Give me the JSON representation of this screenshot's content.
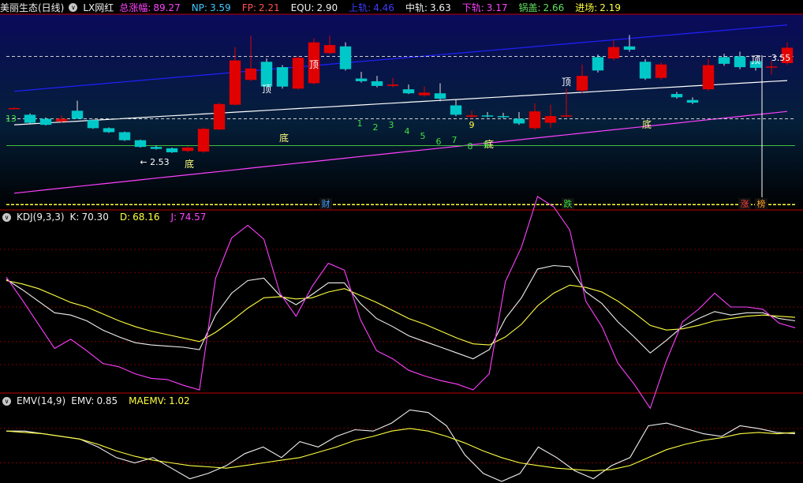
{
  "main_header": {
    "stock_name": "美丽生态(日线)",
    "indicator_name": "LX网红",
    "items": [
      {
        "label": "总涨幅:",
        "value": "89.27",
        "color": "#ff40ff"
      },
      {
        "label": "NP:",
        "value": "3.59",
        "color": "#40c8ff"
      },
      {
        "label": "FP:",
        "value": "2.21",
        "color": "#ff5050"
      },
      {
        "label": "EQU:",
        "value": "2.90",
        "color": "#f0f0f0"
      },
      {
        "label": "上轨:",
        "value": "4.46",
        "color": "#3c3cff"
      },
      {
        "label": "中轨:",
        "value": "3.63",
        "color": "#f0f0f0"
      },
      {
        "label": "下轨:",
        "value": "3.17",
        "color": "#ff40ff"
      },
      {
        "label": "锅盖:",
        "value": "2.66",
        "color": "#60e060"
      },
      {
        "label": "进场:",
        "value": "2.19",
        "color": "#ffff40"
      }
    ]
  },
  "kdj_header": {
    "title": "KDJ(9,3,3)",
    "items": [
      {
        "label": "K:",
        "value": "70.30",
        "color": "#f0f0f0"
      },
      {
        "label": "D:",
        "value": "68.16",
        "color": "#ffff40"
      },
      {
        "label": "J:",
        "value": "74.57",
        "color": "#ff40ff"
      }
    ]
  },
  "emv_header": {
    "title": "EMV(14,9)",
    "items": [
      {
        "label": "EMV:",
        "value": "0.85",
        "color": "#f0f0f0"
      },
      {
        "label": "MAEMV:",
        "value": "1.02",
        "color": "#ffff40"
      }
    ]
  },
  "colors": {
    "up": "#e00000",
    "down": "#00c8c8",
    "mid": "#ffffff",
    "lower": "#ff40ff",
    "upper": "#2020ff",
    "entry": "#ffff40",
    "pot": "#40c040",
    "kdj_k": "#f0f0f0",
    "kdj_d": "#ffff40",
    "kdj_j": "#ff40ff",
    "emv": "#f0f0f0",
    "maemv": "#ffff40",
    "separator": "#c00000"
  },
  "chart_data": [
    {
      "type": "candlestick",
      "x": [
        1,
        2,
        3,
        4,
        5,
        6,
        7,
        8,
        9,
        10,
        11,
        12,
        13,
        14,
        15,
        16,
        17,
        18,
        19,
        20,
        21,
        22,
        23,
        24,
        25,
        26,
        27,
        28,
        29,
        30,
        31,
        32,
        33,
        34,
        35,
        36,
        37,
        38,
        39,
        40,
        41,
        42,
        43,
        44,
        45,
        46,
        47,
        48,
        49,
        50
      ],
      "open": [
        3.22,
        3.12,
        3.06,
        3.02,
        3.18,
        3.04,
        2.92,
        2.86,
        2.74,
        2.64,
        2.62,
        2.58,
        2.57,
        2.9,
        3.27,
        3.64,
        3.91,
        3.83,
        3.51,
        3.59,
        4.04,
        4.14,
        3.66,
        3.62,
        3.55,
        3.5,
        3.41,
        3.44,
        3.26,
        3.09,
        3.11,
        3.1,
        3.06,
        2.92,
        3.0,
        3.11,
        3.48,
        3.98,
        3.96,
        4.14,
        3.91,
        3.67,
        3.43,
        3.34,
        3.5,
        3.98,
        3.99,
        3.92,
        3.84,
        3.89
      ],
      "close": [
        3.22,
        3.0,
        2.97,
        3.06,
        3.06,
        2.92,
        2.86,
        2.74,
        2.64,
        2.61,
        2.56,
        2.63,
        2.91,
        3.28,
        3.93,
        3.81,
        3.54,
        3.54,
        3.97,
        4.2,
        4.16,
        3.8,
        3.62,
        3.55,
        3.57,
        3.44,
        3.45,
        3.36,
        3.12,
        3.11,
        3.1,
        3.09,
        2.99,
        3.17,
        3.1,
        3.11,
        3.7,
        3.78,
        4.13,
        4.09,
        3.66,
        3.87,
        3.38,
        3.3,
        3.86,
        3.88,
        3.83,
        3.82,
        3.84,
        4.12
      ],
      "high": [
        3.23,
        3.14,
        3.08,
        3.11,
        3.33,
        3.05,
        2.93,
        2.87,
        2.75,
        2.66,
        2.63,
        2.65,
        2.93,
        3.3,
        4.13,
        4.3,
        3.96,
        3.86,
        4.0,
        4.26,
        4.3,
        4.2,
        3.76,
        3.7,
        3.67,
        3.57,
        3.54,
        3.59,
        3.35,
        3.18,
        3.16,
        3.15,
        3.16,
        3.29,
        3.27,
        3.51,
        3.87,
        4.02,
        4.23,
        4.31,
        3.95,
        3.9,
        3.46,
        3.38,
        3.95,
        4.03,
        4.06,
        3.96,
        3.92,
        4.2
      ],
      "low": [
        3.21,
        2.99,
        2.96,
        3.0,
        3.06,
        2.91,
        2.85,
        2.73,
        2.63,
        2.6,
        2.55,
        2.56,
        2.55,
        2.89,
        3.26,
        3.62,
        3.53,
        3.51,
        3.49,
        3.57,
        4.02,
        3.78,
        3.6,
        3.53,
        3.53,
        3.43,
        3.39,
        3.32,
        3.1,
        3.06,
        3.08,
        3.07,
        2.97,
        2.89,
        2.92,
        3.08,
        3.44,
        3.75,
        3.93,
        4.06,
        3.64,
        3.64,
        3.36,
        3.28,
        3.48,
        3.85,
        3.8,
        3.78,
        3.72,
        3.86
      ],
      "top_labels": [
        "顶",
        "顶",
        "顶",
        "顶",
        "顶"
      ],
      "bottom_labels": [
        "底",
        "底",
        "底",
        "底",
        "底"
      ],
      "count_labels": [
        "1",
        "2",
        "3",
        "4",
        "5",
        "6",
        "7",
        "8",
        "9",
        "9",
        "13"
      ],
      "price_labels": [
        "2.53",
        "3.55"
      ],
      "event_labels": [
        "财",
        "跌",
        "涨",
        "榜"
      ],
      "yrange": [
        1.7,
        4.62
      ]
    },
    {
      "type": "line",
      "title": "KDJ(9,3,3)",
      "series": [
        {
          "name": "K",
          "values": [
            74,
            65,
            55,
            45,
            43,
            38,
            30,
            24,
            19,
            17,
            16,
            15,
            13,
            43,
            62,
            73,
            75,
            60,
            52,
            61,
            71,
            71,
            53,
            40,
            33,
            25,
            20,
            15,
            10,
            5,
            13,
            40,
            58,
            83,
            86,
            85,
            63,
            53,
            37,
            24,
            10,
            21,
            33,
            40,
            46,
            43,
            45,
            45,
            40,
            38
          ]
        },
        {
          "name": "D",
          "values": [
            73,
            70,
            66,
            60,
            54,
            50,
            44,
            38,
            33,
            29,
            26,
            23,
            20,
            28,
            38,
            49,
            58,
            59,
            57,
            58,
            63,
            66,
            60,
            54,
            47,
            40,
            35,
            29,
            23,
            18,
            17,
            24,
            35,
            51,
            62,
            69,
            67,
            63,
            55,
            45,
            34,
            30,
            31,
            34,
            38,
            40,
            42,
            43,
            42,
            41
          ]
        },
        {
          "name": "J",
          "values": [
            76,
            56,
            35,
            14,
            22,
            12,
            1,
            -2,
            -8,
            -12,
            -13,
            -18,
            -22,
            75,
            110,
            121,
            109,
            62,
            42,
            68,
            88,
            82,
            39,
            12,
            5,
            -5,
            -10,
            -14,
            -17,
            -22,
            -8,
            72,
            102,
            146,
            137,
            117,
            55,
            33,
            1,
            -17,
            -38,
            3,
            37,
            48,
            62,
            50,
            50,
            48,
            36,
            32
          ]
        }
      ],
      "yrange": [
        -22,
        122
      ]
    },
    {
      "type": "line",
      "title": "EMV(14,9)",
      "series": [
        {
          "name": "EMV",
          "values": [
            82,
            82,
            80,
            78,
            76,
            70,
            62,
            58,
            62,
            54,
            46,
            50,
            56,
            65,
            70,
            62,
            74,
            70,
            78,
            83,
            82,
            88,
            98,
            96,
            86,
            64,
            50,
            44,
            50,
            70,
            62,
            52,
            46,
            56,
            62,
            86,
            88,
            84,
            80,
            78,
            86,
            84,
            81,
            80
          ]
        },
        {
          "name": "MAEMV",
          "values": [
            82,
            81,
            80,
            78,
            76,
            72,
            67,
            63,
            60,
            58,
            56,
            55,
            54,
            56,
            58,
            60,
            62,
            66,
            70,
            75,
            78,
            82,
            84,
            82,
            78,
            73,
            67,
            62,
            58,
            56,
            54,
            53,
            52,
            53,
            56,
            62,
            68,
            72,
            75,
            77,
            80,
            81,
            80,
            81
          ]
        }
      ],
      "yrange": [
        44,
        100
      ]
    }
  ]
}
